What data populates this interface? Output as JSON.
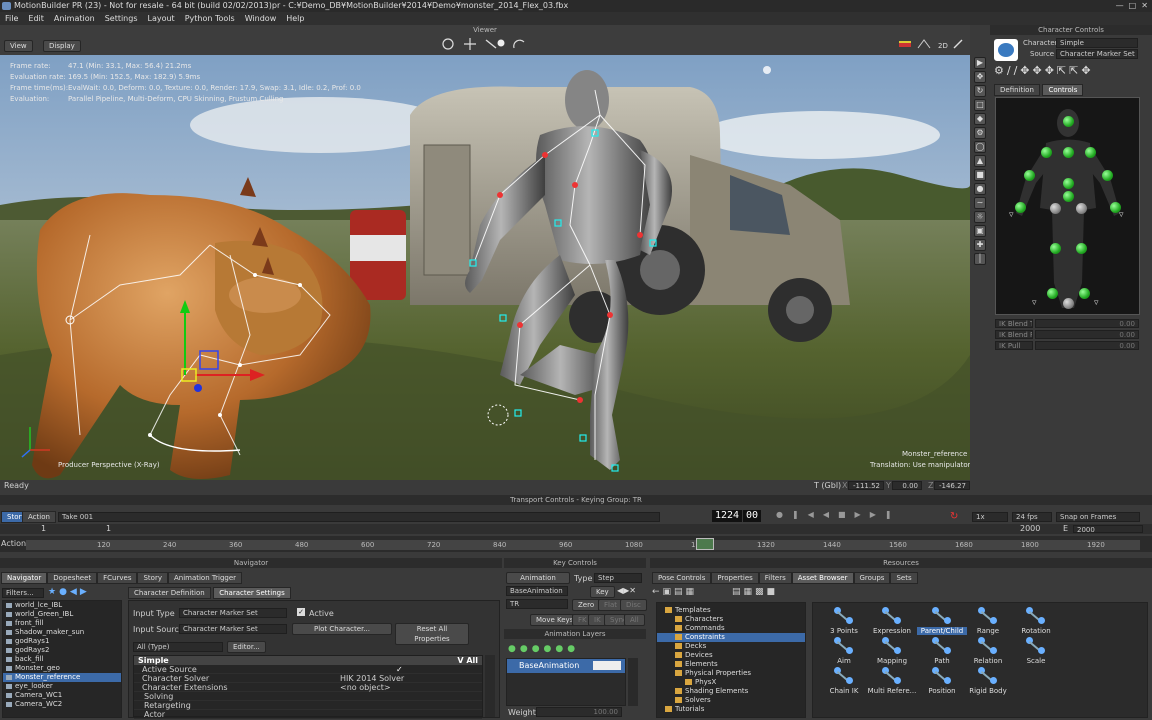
{
  "title_bar": {
    "text": "MotionBuilder PR (23) - Not for resale - 64 bit (build 02/02/2013)pr - C:¥Demo_DB¥MotionBuilder¥2014¥Demo¥monster_2014_Flex_03.fbx"
  },
  "menu": [
    "File",
    "Edit",
    "Animation",
    "Settings",
    "Layout",
    "Python Tools",
    "Window",
    "Help"
  ],
  "viewer": {
    "title": "Viewer",
    "view_btn": "View",
    "display_btn": "Display",
    "stats": [
      {
        "label": "Frame rate:",
        "value": "47.1  (Min: 33.1, Max: 56.4)  21.2ms"
      },
      {
        "label": "Evaluation rate:",
        "value": "169.5  (Min: 152.5, Max: 182.9)  5.9ms"
      },
      {
        "label": "Frame time(ms):",
        "value": "EvalWait: 0.0, Deform: 0.0, Texture: 0.0, Render: 17.9, Swap: 3.1, Idle: 0.2, Prof: 0.0"
      },
      {
        "label": "Evaluation:",
        "value": "Parallel Pipeline, Multi-Deform, CPU Skinning, Frustum Culling"
      }
    ],
    "camera_label": "Producer Perspective (X-Ray)",
    "object_label": "Monster_reference",
    "mode_label": "Translation: Use manipulator",
    "status": "Ready",
    "coords": {
      "t_label": "T (Gbl)",
      "x": "-111.52",
      "y": "0.00",
      "z": "-146.27"
    }
  },
  "character_controls": {
    "title": "Character Controls",
    "character_label": "Character",
    "character_value": "Simple",
    "source_label": "Source",
    "source_value": "Character Marker Set",
    "tabs": [
      "Definition",
      "Controls"
    ],
    "active_tab": "Controls",
    "blend_rows": [
      {
        "label": "IK Blend T",
        "value": "0.00"
      },
      {
        "label": "IK Blend R",
        "value": "0.00"
      },
      {
        "label": "IK Pull",
        "value": "0.00"
      }
    ]
  },
  "transport": {
    "title": "Transport Controls  -  Keying Group: TR",
    "story_btn": "Story",
    "action_btn": "Action",
    "take": "Take 001",
    "frame": "1224",
    "frame_sub": "00",
    "speed": "1x",
    "fps": "24 fps",
    "snap": "Snap on Frames",
    "start": "1",
    "end_left": "1",
    "end_right": "2000",
    "e_label": "E",
    "e_value": "2000",
    "ruler_label": "Action",
    "ticks": [
      "120",
      "240",
      "360",
      "480",
      "600",
      "720",
      "840",
      "960",
      "1080",
      "1200",
      "1320",
      "1440",
      "1560",
      "1680",
      "1800",
      "1920"
    ]
  },
  "navigator": {
    "title": "Navigator",
    "tabs": [
      "Navigator",
      "Dopesheet",
      "FCurves",
      "Story",
      "Animation Trigger"
    ],
    "filters": "Filters...",
    "items": [
      "world_lce_IBL",
      "world_Green_IBL",
      "front_fill",
      "Shadow_maker_sun",
      "godRays1",
      "godRays2",
      "back_fill",
      "Monster_geo",
      "Monster_reference",
      "eye_looker",
      "Camera_WC1",
      "Camera_WC2"
    ],
    "selected": "Monster_reference",
    "subtabs": [
      "Character Definition",
      "Character Settings"
    ],
    "input_type_label": "Input Type",
    "input_type_value": "Character Marker Set",
    "active_label": "Active",
    "input_source_label": "Input Source",
    "input_source_value": "Character Marker Set",
    "plot_btn": "Plot Character...",
    "reset_btn": "Reset All Properties",
    "all_type": "All (Type)",
    "editor_btn": "Editor...",
    "group": "Simple",
    "group_right": "V All",
    "props": [
      {
        "name": "Active Source",
        "value": ""
      },
      {
        "name": "Character Solver",
        "value": "HIK 2014 Solver"
      },
      {
        "name": "Character Extensions",
        "value": "<no object>"
      },
      {
        "name": "Solving",
        "value": ""
      },
      {
        "name": "Retargeting",
        "value": ""
      },
      {
        "name": "Actor",
        "value": ""
      }
    ]
  },
  "key_controls": {
    "title": "Key Controls",
    "animation_btn": "Animation",
    "type_label": "Type",
    "type_value": "Step",
    "layer": "BaseAnimation",
    "key_btn": "Key",
    "tr_value": "TR",
    "zero_btn": "Zero",
    "flat_btn": "Flat",
    "disc_btn": "Disc",
    "move_keys": "Move Keys",
    "fk_btn": "FK",
    "ik_btn": "IK",
    "sync_btn": "Sync",
    "all_btn": "All",
    "layers_title": "Animation Layers",
    "base_layer": "BaseAnimation",
    "weight_label": "Weight",
    "weight_value": "100.00"
  },
  "resources": {
    "title": "Resources",
    "tabs": [
      "Pose Controls",
      "Properties",
      "Filters",
      "Asset Browser",
      "Groups",
      "Sets"
    ],
    "active_tab": "Asset Browser",
    "tree": [
      "Templates",
      "Characters",
      "Commands",
      "Constraints",
      "Decks",
      "Devices",
      "Elements",
      "Physical Properties",
      "PhysX",
      "Shading Elements",
      "Solvers",
      "Tutorials"
    ],
    "tree_selected": "Constraints",
    "items": [
      "3 Points",
      "Expression",
      "Parent/Child",
      "Range",
      "Rotation",
      "Aim",
      "Mapping",
      "Path",
      "Relation",
      "Scale",
      "Chain IK",
      "Multi Refere...",
      "Position",
      "Rigid Body"
    ],
    "item_selected": "Parent/Child"
  }
}
